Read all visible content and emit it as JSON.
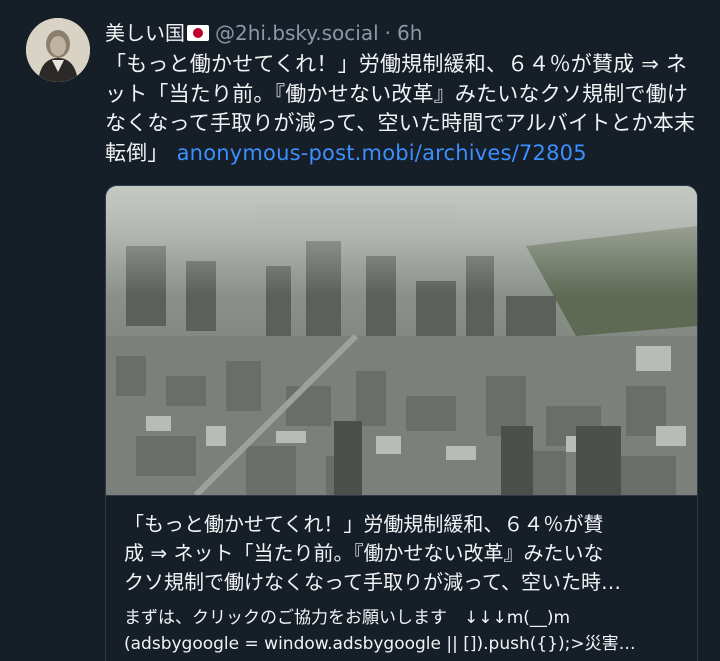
{
  "post": {
    "display_name": "美しい国",
    "handle": "@2hi.bsky.social",
    "separator": "·",
    "time": "6h",
    "text": "「もっと働かせてくれ！」労働規制緩和、６４％が賛成 ⇒ ネット「当たり前。『働かせない改革』みたいなクソ規制で働けなくなって手取りが減って、空いた時間でアルバイトとか本末転倒」",
    "link_text": "anonymous-post.mobi/archives/72805"
  },
  "card": {
    "title_line1": "「もっと働かせてくれ！」労働規制緩和、６４％が賛",
    "title_line2": "成 ⇒ ネット「当たり前。『働かせない改革』みたいな",
    "title_line3": "クソ規制で働けなくなって手取りが減って、空いた時…",
    "desc_line1": "まずは、クリックのご協力をお願いします　↓↓↓m(__)m",
    "desc_line2": "(adsbygoogle = window.adsbygoogle || []).push({});>災害…"
  },
  "icons": {
    "flag": "japan-flag-icon"
  },
  "colors": {
    "background": "#161e27",
    "link": "#3b90ff",
    "muted": "#8b98a5",
    "border": "#2e3a47"
  }
}
